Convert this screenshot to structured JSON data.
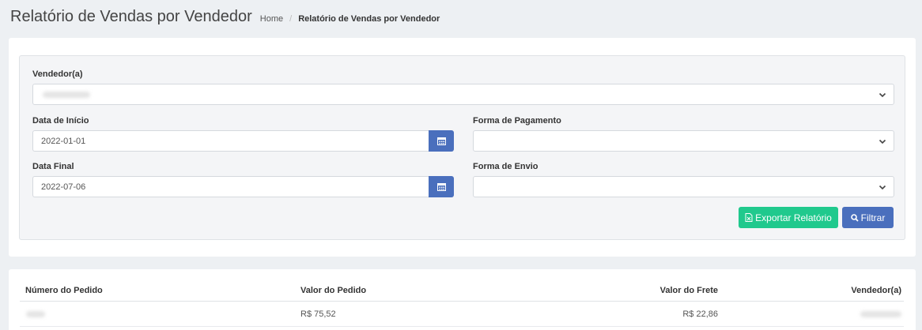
{
  "header": {
    "title": "Relatório de Vendas por Vendedor",
    "breadcrumb": {
      "home": "Home",
      "separator": "/",
      "current": "Relatório de Vendas por Vendedor"
    }
  },
  "filters": {
    "vendedor": {
      "label": "Vendedor(a)",
      "value": ""
    },
    "data_inicio": {
      "label": "Data de Início",
      "value": "2022-01-01"
    },
    "data_final": {
      "label": "Data Final",
      "value": "2022-07-06"
    },
    "forma_pagamento": {
      "label": "Forma de Pagamento",
      "value": ""
    },
    "forma_envio": {
      "label": "Forma de Envio",
      "value": ""
    }
  },
  "actions": {
    "export_label": "Exportar Relatório",
    "filter_label": "Filtrar"
  },
  "table": {
    "columns": [
      "Número do Pedido",
      "Valor do Pedido",
      "Valor do Frete",
      "Vendedor(a)"
    ],
    "rows": [
      {
        "pedido": "",
        "valor_pedido": "R$ 75,52",
        "valor_frete": "R$ 22,86",
        "vendedor": ""
      }
    ]
  },
  "colors": {
    "primary": "#4a6fbd",
    "success": "#20c98d",
    "background": "#edf0f3"
  }
}
